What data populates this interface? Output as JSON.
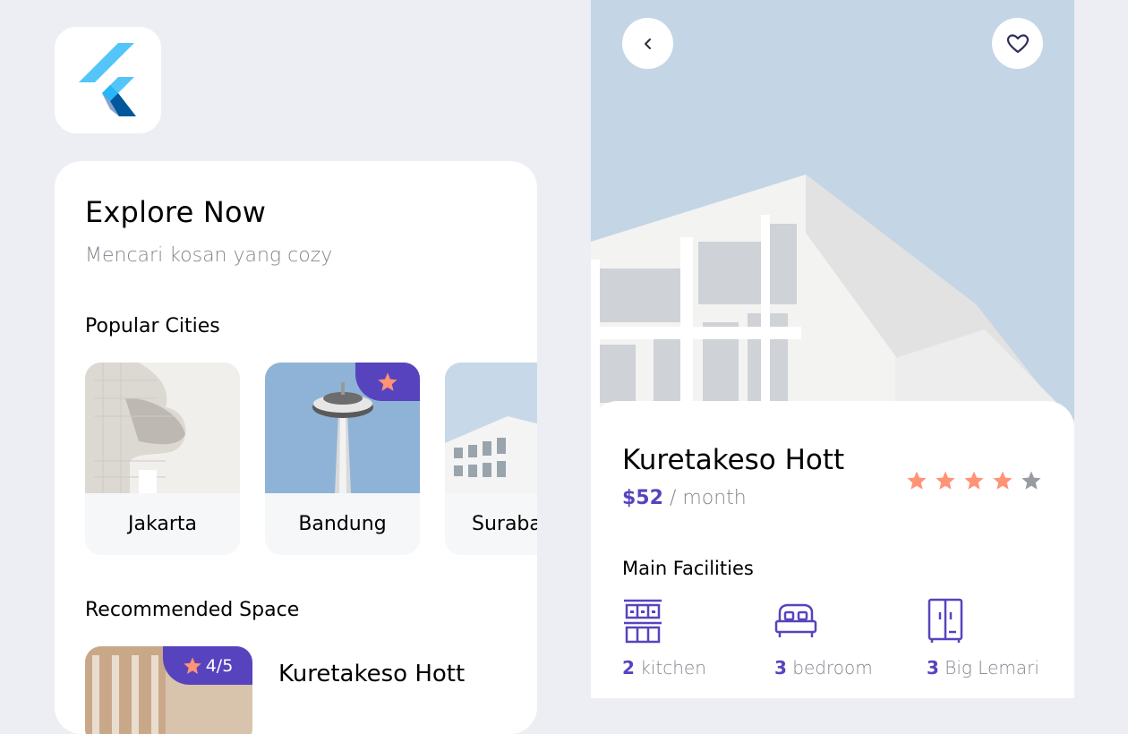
{
  "colors": {
    "background": "#eceef3",
    "primary": "#5843be",
    "star_active": "#ff9376",
    "star_inactive": "#989ba1",
    "text_muted": "#82868e"
  },
  "app_icon": {
    "name": "flutter-logo"
  },
  "explore": {
    "title": "Explore Now",
    "subtitle": "Mencari kosan yang cozy",
    "popular_title": "Popular Cities",
    "cities": [
      {
        "name": "Jakarta",
        "favorite": false,
        "icon": ""
      },
      {
        "name": "Bandung",
        "favorite": true,
        "icon": "star-icon"
      },
      {
        "name": "Surabaya",
        "favorite": false,
        "icon": ""
      }
    ],
    "recommended_title": "Recommended Space",
    "recommended": [
      {
        "name": "Kuretakeso Hott",
        "rating": "4/5"
      }
    ]
  },
  "detail": {
    "back_icon": "chevron-left-icon",
    "favorite_icon": "heart-icon",
    "name": "Kuretakeso Hott",
    "price": "$52",
    "price_unit": "/ month",
    "rating": 4,
    "rating_max": 5,
    "facilities_title": "Main Facilities",
    "facilities": [
      {
        "count": "2",
        "label": "kitchen",
        "icon": "kitchen-icon"
      },
      {
        "count": "3",
        "label": "bedroom",
        "icon": "bed-icon"
      },
      {
        "count": "3",
        "label": "Big Lemari",
        "icon": "wardrobe-icon"
      }
    ]
  }
}
